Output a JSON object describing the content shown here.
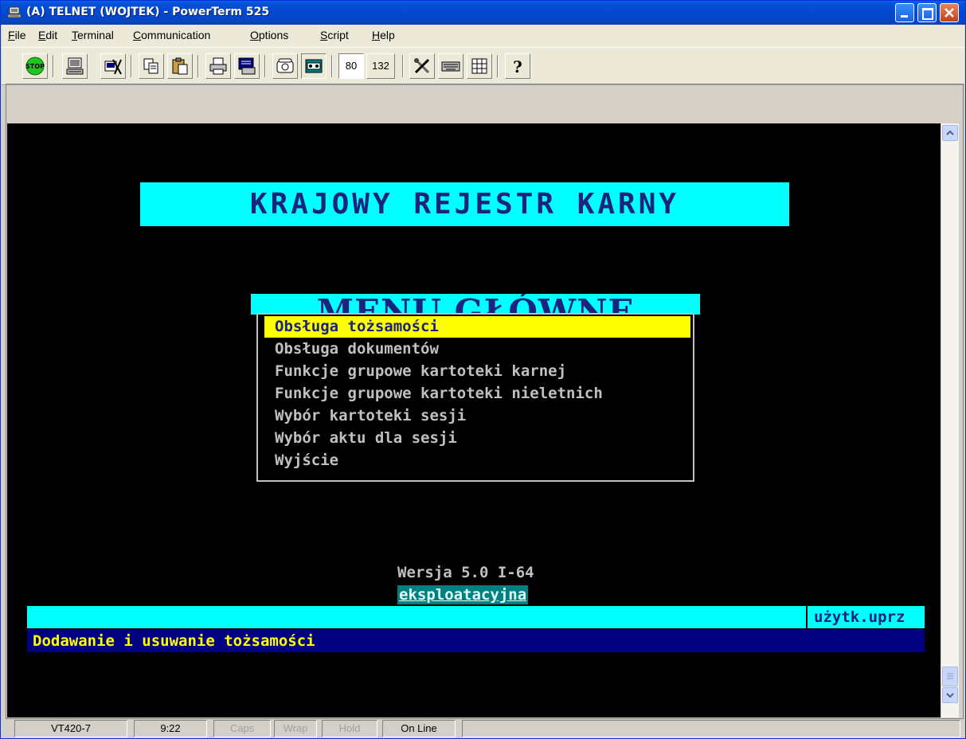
{
  "window": {
    "title": "(A) TELNET (WOJTEK) - PowerTerm 525"
  },
  "menubar": {
    "items": [
      {
        "label": "File",
        "u": "F",
        "rest": "ile"
      },
      {
        "label": "Edit",
        "u": "E",
        "rest": "dit"
      },
      {
        "label": "Terminal",
        "u": "T",
        "rest": "erminal"
      },
      {
        "label": "Communication",
        "u": "C",
        "rest": "ommunication"
      },
      {
        "label": "Options",
        "u": "O",
        "rest": "ptions"
      },
      {
        "label": "Script",
        "u": "S",
        "rest": "cript"
      },
      {
        "label": "Help",
        "u": "H",
        "rest": "elp"
      }
    ]
  },
  "toolbar": {
    "stop_label": "STOP",
    "cols80": "80",
    "cols132": "132",
    "help_label": "?"
  },
  "terminal": {
    "banner": "KRAJOWY REJESTR KARNY",
    "menu_header": "MENU GŁÓWNE",
    "menu_options": [
      "Obsługa tożsamości",
      "Obsługa dokumentów",
      "Funkcje grupowe kartoteki karnej",
      "Funkcje grupowe kartoteki nieletnich",
      "Wybór kartoteki sesji",
      "Wybór aktu dla sesji",
      "Wyjście"
    ],
    "selected_index": 0,
    "version": "Wersja 5.0 I-64",
    "build_type": "eksploatacyjna",
    "user": "użytk.uprz",
    "hint": "Dodawanie i usuwanie tożsamości"
  },
  "statusbar": {
    "terminal_type": "VT420-7",
    "time": "9:22",
    "caps": "Caps",
    "wrap": "Wrap",
    "hold": "Hold",
    "connection": "On Line"
  },
  "colors": {
    "terminal_bg": "#000000",
    "cyan": "#00ffff",
    "highlight": "#ffff00",
    "navy": "#000080",
    "title_text": "#1a237e"
  }
}
